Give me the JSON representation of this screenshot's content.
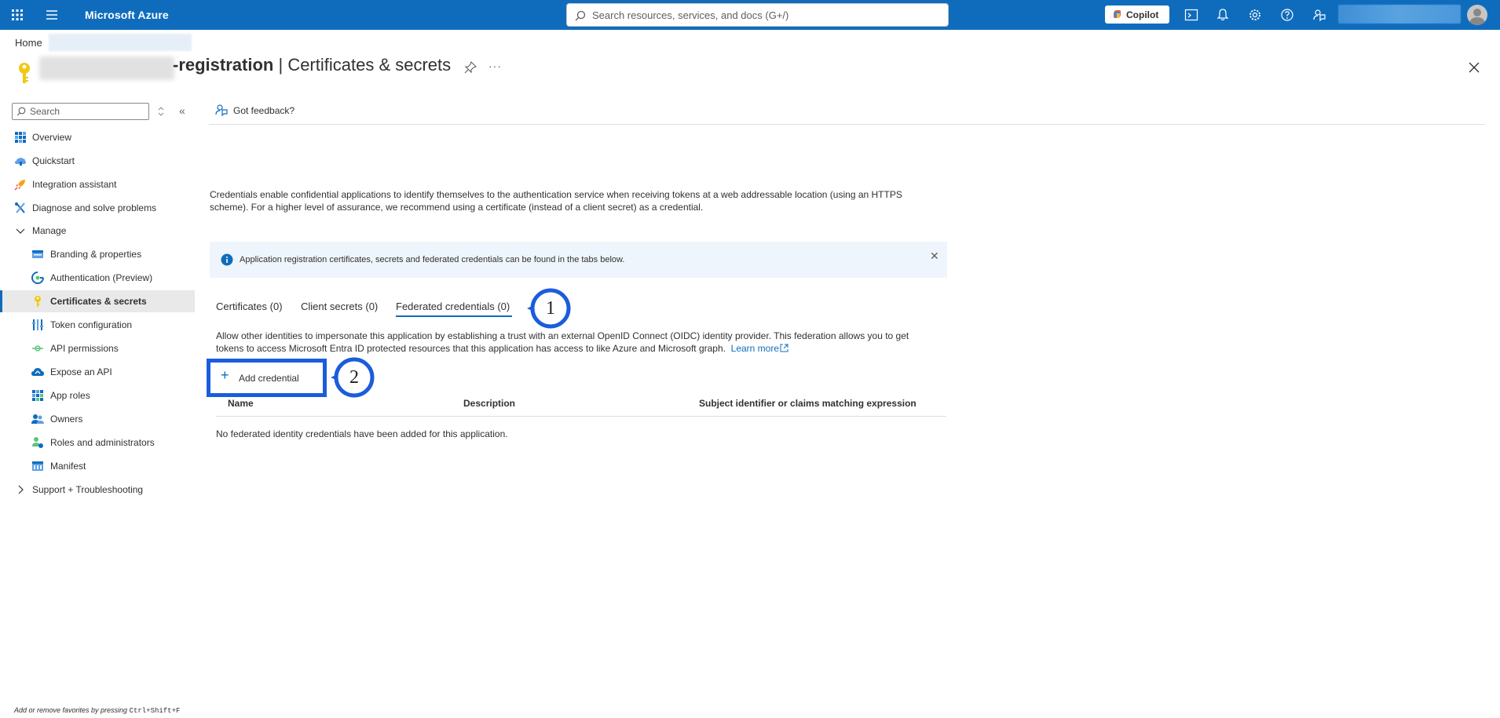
{
  "topbar": {
    "brand": "Microsoft Azure",
    "search_placeholder": "Search resources, services, and docs (G+/)",
    "copilot_label": "Copilot",
    "icons": [
      "cloud-shell-icon",
      "bell-icon",
      "gear-icon",
      "help-icon",
      "feedback-icon"
    ],
    "color": "#0f6cbd"
  },
  "breadcrumb": {
    "home": "Home"
  },
  "title": {
    "app_suffix": "-registration",
    "separator": " | ",
    "section": "Certificates & secrets",
    "more": "···"
  },
  "sidebar": {
    "search_placeholder": "Search",
    "collapse": "«",
    "items": [
      {
        "label": "Overview",
        "icon": "overview-icon"
      },
      {
        "label": "Quickstart",
        "icon": "quickstart-icon"
      },
      {
        "label": "Integration assistant",
        "icon": "rocket-icon"
      },
      {
        "label": "Diagnose and solve problems",
        "icon": "wrench-icon"
      },
      {
        "label": "Manage",
        "icon": "chevron-down-icon"
      },
      {
        "label": "Branding & properties",
        "icon": "branding-icon"
      },
      {
        "label": "Authentication (Preview)",
        "icon": "authentication-icon"
      },
      {
        "label": "Certificates & secrets",
        "icon": "key-icon",
        "active": true
      },
      {
        "label": "Token configuration",
        "icon": "token-icon"
      },
      {
        "label": "API permissions",
        "icon": "api-permissions-icon"
      },
      {
        "label": "Expose an API",
        "icon": "cloud-icon"
      },
      {
        "label": "App roles",
        "icon": "app-roles-icon"
      },
      {
        "label": "Owners",
        "icon": "owners-icon"
      },
      {
        "label": "Roles and administrators",
        "icon": "roles-icon"
      },
      {
        "label": "Manifest",
        "icon": "manifest-icon"
      },
      {
        "label": "Support + Troubleshooting",
        "icon": "chevron-right-icon"
      }
    ],
    "footer": {
      "text": "Add or remove favorites by pressing ",
      "shortcut": "Ctrl+Shift+F"
    }
  },
  "content": {
    "feedback": "Got feedback?",
    "intro": "Credentials enable confidential applications to identify themselves to the authentication service when receiving tokens at a web addressable location (using an HTTPS scheme). For a higher level of assurance, we recommend using a certificate (instead of a client secret) as a credential.",
    "info": "Application registration certificates, secrets and federated credentials can be found in the tabs below.",
    "tabs": [
      {
        "label": "Certificates (0)"
      },
      {
        "label": "Client secrets (0)"
      },
      {
        "label": "Federated credentials (0)",
        "selected": true
      }
    ],
    "federated_desc": "Allow other identities to impersonate this application by establishing a trust with an external OpenID Connect (OIDC) identity provider. This federation allows you to get tokens to access Microsoft Entra ID protected resources that this application has access to like Azure and Microsoft graph.",
    "learn_more": "Learn more",
    "add_credential": "Add credential",
    "table": {
      "columns": [
        "Name",
        "Description",
        "Subject identifier or claims matching expression"
      ],
      "empty": "No federated identity credentials have been added for this application."
    }
  },
  "annotations": [
    {
      "number": "1",
      "target": "Federated credentials tab"
    },
    {
      "number": "2",
      "target": "Add credential button"
    }
  ],
  "colors": {
    "accent": "#0f6cbd",
    "callout": "#1a5ddc",
    "info_bg": "#eef5fc"
  }
}
